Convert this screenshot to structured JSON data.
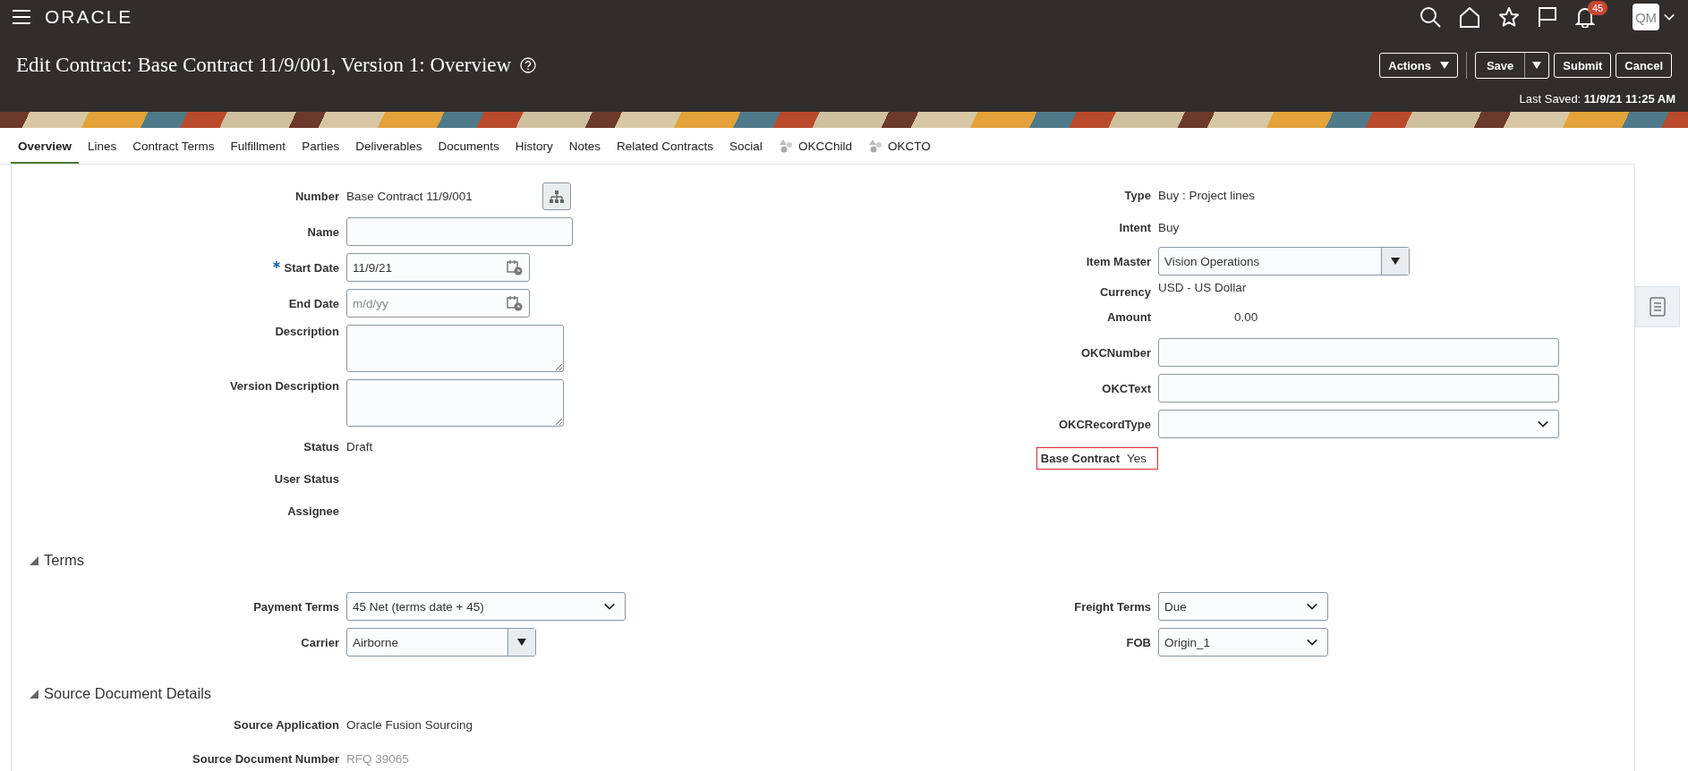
{
  "header": {
    "logo": "ORACLE",
    "notification_count": "45",
    "avatar_initials": "QM"
  },
  "page": {
    "title": "Edit Contract: Base Contract 11/9/001, Version 1: Overview",
    "last_saved_label": "Last Saved:",
    "last_saved_value": "11/9/21 11:25 AM"
  },
  "actions": [
    {
      "label": "Actions",
      "kind": "menu"
    },
    {
      "label": "Save",
      "kind": "split"
    },
    {
      "label": "Submit",
      "kind": "plain"
    },
    {
      "label": "Cancel",
      "kind": "plain"
    }
  ],
  "tabs": [
    {
      "label": "Overview",
      "selected": true,
      "kind": "text"
    },
    {
      "label": "Lines",
      "selected": false,
      "kind": "text"
    },
    {
      "label": "Contract Terms",
      "selected": false,
      "kind": "text"
    },
    {
      "label": "Fulfillment",
      "selected": false,
      "kind": "text"
    },
    {
      "label": "Parties",
      "selected": false,
      "kind": "text"
    },
    {
      "label": "Deliverables",
      "selected": false,
      "kind": "text"
    },
    {
      "label": "Documents",
      "selected": false,
      "kind": "text"
    },
    {
      "label": "History",
      "selected": false,
      "kind": "text"
    },
    {
      "label": "Notes",
      "selected": false,
      "kind": "text"
    },
    {
      "label": "Related Contracts",
      "selected": false,
      "kind": "text"
    },
    {
      "label": "Social",
      "selected": false,
      "kind": "text"
    },
    {
      "label": "OKCChild",
      "selected": false,
      "kind": "icon"
    },
    {
      "label": "OKCTO",
      "selected": false,
      "kind": "icon"
    }
  ],
  "left_fields": [
    {
      "label": "Number",
      "kind": "text-with-button",
      "value": "Base Contract 11/9/001"
    },
    {
      "label": "Name",
      "kind": "input"
    },
    {
      "label": "Start Date",
      "kind": "date",
      "value": "11/9/21",
      "required": true
    },
    {
      "label": "End Date",
      "kind": "date",
      "placeholder": "m/d/yy",
      "required": false
    },
    {
      "label": "Description",
      "kind": "textarea"
    },
    {
      "label": "Version Description",
      "kind": "textarea"
    },
    {
      "label": "Status",
      "kind": "text",
      "value": "Draft"
    },
    {
      "label": "User Status",
      "kind": "text"
    },
    {
      "label": "Assignee",
      "kind": "text"
    }
  ],
  "right_fields": [
    {
      "label": "Type",
      "kind": "text",
      "value": "Buy : Project lines"
    },
    {
      "label": "Intent",
      "kind": "text",
      "value": "Buy"
    },
    {
      "label": "Item Master",
      "kind": "combo",
      "value": "Vision Operations"
    },
    {
      "label": "Currency",
      "kind": "raised",
      "value": "USD - US Dollar"
    },
    {
      "label": "Amount",
      "kind": "amount",
      "value": "0.00"
    },
    {
      "label": "OKCNumber",
      "kind": "input"
    },
    {
      "label": "OKCText",
      "kind": "input"
    },
    {
      "label": "OKCRecordType",
      "kind": "select"
    },
    {
      "label": "Base Contract",
      "kind": "text",
      "value": "Yes",
      "highlighted": true
    }
  ],
  "sections": [
    {
      "title": "Terms",
      "expanded": true,
      "left_fields": [
        {
          "label": "Payment Terms",
          "kind": "select",
          "value": "45 Net (terms date + 45)"
        },
        {
          "label": "Carrier",
          "kind": "combo",
          "value": "Airborne"
        }
      ],
      "right_fields": [
        {
          "label": "Freight Terms",
          "kind": "select",
          "value": "Due"
        },
        {
          "label": "FOB",
          "kind": "select",
          "value": "Origin_1"
        }
      ]
    },
    {
      "title": "Source Document Details",
      "expanded": true,
      "left_fields": [
        {
          "label": "Source Application",
          "kind": "text",
          "value": "Oracle Fusion Sourcing",
          "muted": false
        },
        {
          "label": "Source Document Number",
          "kind": "text",
          "value": "RFQ 39065",
          "muted": true
        }
      ]
    }
  ]
}
